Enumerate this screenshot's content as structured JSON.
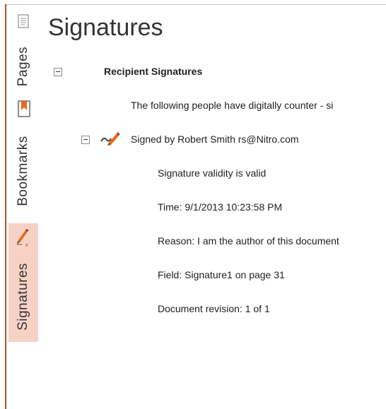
{
  "sidebar": {
    "tabs": [
      {
        "label": "Pages",
        "icon": "pages-icon"
      },
      {
        "label": "Bookmarks",
        "icon": "bookmark-icon"
      },
      {
        "label": "Signatures",
        "icon": "signature-pen-icon"
      }
    ],
    "active_tab_color": "#f6d2c5",
    "accent_color": "#e8671c"
  },
  "panel": {
    "title": "Signatures",
    "section_heading": "Recipient Signatures",
    "description": "The following people have digitally counter - si",
    "signer": {
      "line": "Signed by Robert Smith rs@Nitro.com",
      "validity": "Signature validity is valid",
      "time": "Time: 9/1/2013 10:23:58 PM",
      "reason": "Reason: I am the author of this document",
      "field": "Field: Signature1 on page 31",
      "revision": "Document revision: 1 of 1"
    }
  }
}
